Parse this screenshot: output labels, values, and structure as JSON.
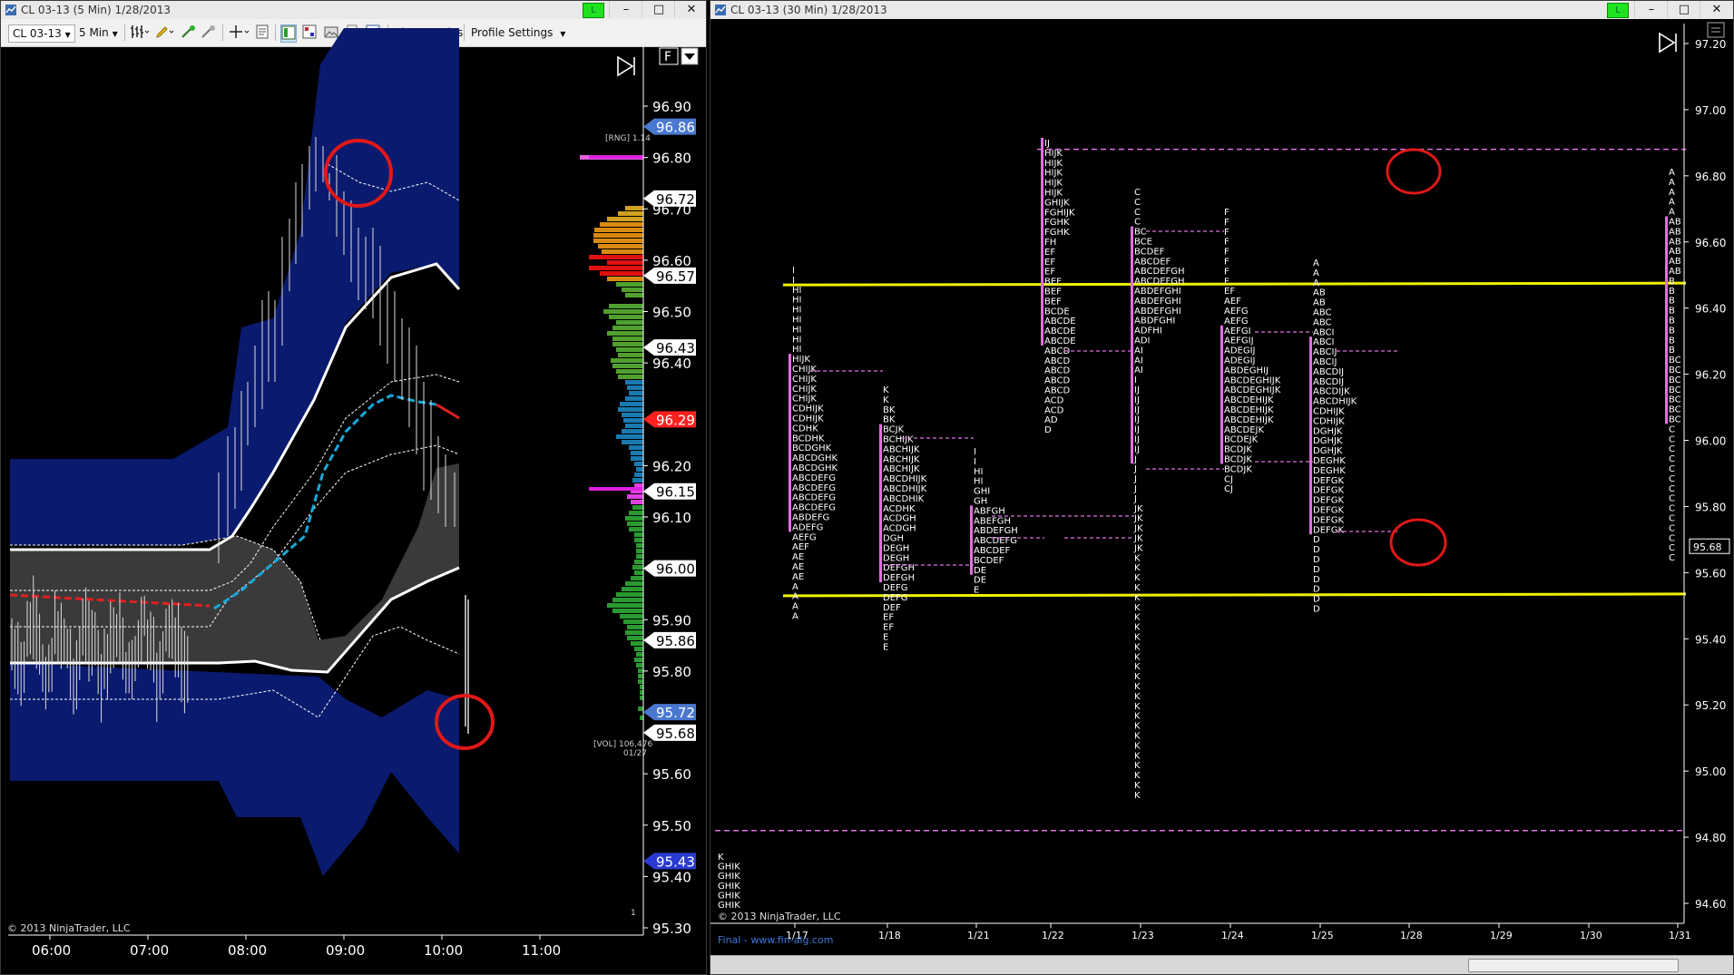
{
  "left_window": {
    "title": "CL 03-13 (5 Min)  1/28/2013",
    "toolbar": {
      "instrument": "CL 03-13",
      "interval": "5 Min",
      "show_trades": "Show Trades",
      "profile_settings": "Profile Settings"
    },
    "connection_label": "L",
    "price_markers": [
      "96.86",
      "96.72",
      "96.57",
      "96.43",
      "96.29",
      "96.15",
      "96.00",
      "95.86",
      "95.72",
      "95.68",
      "95.43"
    ],
    "marker_colors": [
      "#4a78d0",
      "#ffffff",
      "#ffffff",
      "#ffffff",
      "#ff2020",
      "#ffffff",
      "#ffffff",
      "#ffffff",
      "#4a78d0",
      "#ffffff",
      "#2a3ad0"
    ],
    "rng_label": "[RNG] 1.14",
    "vol_label": "[VOL] 106,476",
    "vol_date": "01/27",
    "ninja_copyright": "© 2013 NinjaTrader, LLC",
    "x_ticks": [
      "06:00",
      "07:00",
      "08:00",
      "09:00",
      "10:00",
      "11:00"
    ],
    "small_label": "1",
    "f_button": "F"
  },
  "right_window": {
    "title": "CL 03-13 (30 Min)  1/28/2013",
    "connection_label": "L",
    "price_marker": "95.68",
    "ninja_copyright": "© 2013 NinjaTrader, LLC",
    "final_link": "Final - www.fin-alg.com",
    "x_ticks": [
      "1/17",
      "1/18",
      "1/21",
      "1/22",
      "1/23",
      "1/24",
      "1/25",
      "1/28",
      "1/29",
      "1/30",
      "1/31"
    ],
    "tpo_first": [
      "K",
      "GHIK",
      "GHIK",
      "GHIK",
      "GHIK",
      "GHIK"
    ]
  },
  "colors": {
    "band_blue": "#0a1a6e",
    "band_gray": "#3a3a3a",
    "vwap": "#19a8d8",
    "magenta": "#e070e0",
    "yellow": "#f0f000",
    "circle": "#e01818"
  },
  "chart_data": [
    {
      "type": "candlestick-bands",
      "title": "",
      "xlabel": "",
      "ylabel": "",
      "x": [
        "06:00",
        "07:00",
        "08:00",
        "09:00",
        "10:00",
        "11:00"
      ],
      "ylim": [
        95.25,
        97.02
      ],
      "y_ticks": [
        96.9,
        96.8,
        96.7,
        96.6,
        96.5,
        96.4,
        96.2,
        96.1,
        95.9,
        95.8,
        95.6,
        95.5,
        95.4,
        95.3
      ],
      "grid": false
    },
    {
      "type": "market-profile",
      "title": "",
      "xlabel": "",
      "ylabel": "",
      "x": [
        "1/17",
        "1/18",
        "1/21",
        "1/22",
        "1/23",
        "1/24",
        "1/25",
        "1/28",
        "1/29",
        "1/30",
        "1/31"
      ],
      "ylim": [
        94.55,
        97.25
      ],
      "y_ticks": [
        97.2,
        97.0,
        96.8,
        96.6,
        96.4,
        96.2,
        96.0,
        95.8,
        95.6,
        95.4,
        95.2,
        95.0,
        94.8,
        94.6
      ],
      "series": [
        {
          "values": [
            96.47,
            95.53
          ]
        },
        {
          "values": [
            96.88,
            94.82
          ]
        }
      ],
      "grid": false
    }
  ]
}
